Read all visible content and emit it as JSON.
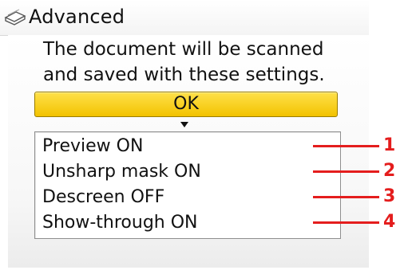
{
  "header": {
    "title": "Advanced",
    "icon": "scan-icon"
  },
  "message": {
    "line1": "The document will be scanned",
    "line2": "and saved with these settings."
  },
  "ok_button": {
    "label": "OK",
    "color": "#f5c400"
  },
  "settings": {
    "items": [
      {
        "label": "Preview ON"
      },
      {
        "label": "Unsharp mask ON"
      },
      {
        "label": "Descreen OFF"
      },
      {
        "label": "Show-through ON"
      }
    ]
  },
  "callouts": {
    "numbers": [
      "1",
      "2",
      "3",
      "4"
    ],
    "color": "#e41d1d"
  }
}
